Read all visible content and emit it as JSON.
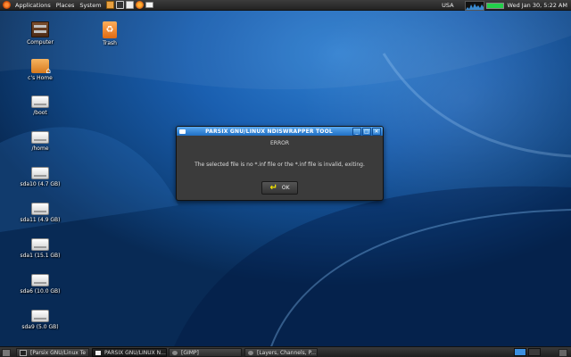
{
  "top_panel": {
    "menus": [
      "Applications",
      "Places",
      "System"
    ],
    "launcher_icons": [
      "file-manager-icon",
      "terminal-icon",
      "text-editor-icon",
      "firefox-icon",
      "email-icon"
    ],
    "keyboard_layout": "USA",
    "clock": "Wed Jan 30,  5:22 AM"
  },
  "desktop": {
    "icons": [
      {
        "label": "Computer",
        "icon": "computer-icon"
      },
      {
        "label": "Trash",
        "icon": "trash-icon"
      },
      {
        "label": "c's Home",
        "icon": "home-folder-icon"
      },
      {
        "label": "/boot",
        "icon": "drive-icon"
      },
      {
        "label": "/home",
        "icon": "drive-icon"
      },
      {
        "label": "sda10 (4.7 GB)",
        "icon": "drive-icon"
      },
      {
        "label": "sda11 (4.9 GB)",
        "icon": "drive-icon"
      },
      {
        "label": "sda1 (15.1 GB)",
        "icon": "drive-icon"
      },
      {
        "label": "sda6 (10.0 GB)",
        "icon": "drive-icon"
      },
      {
        "label": "sda9 (5.0 GB)",
        "icon": "drive-icon"
      }
    ]
  },
  "dialog": {
    "title": "PARSIX GNU/LINUX NDISWRAPPER TOOL",
    "heading": "ERROR",
    "message": "The selected file is no *.inf file or the *.inf file is invalid, exiting.",
    "ok_label": "OK",
    "window_buttons": [
      "_",
      "□",
      "✕"
    ]
  },
  "taskbar": {
    "tasks": [
      {
        "label": "[Parsix GNU/Linux Te",
        "icon": "terminal-icon"
      },
      {
        "label": "PARSIX GNU/LINUX N...",
        "icon": "window-icon"
      },
      {
        "label": "[GIMP]",
        "icon": "gimp-icon"
      },
      {
        "label": "[Layers, Channels, P...",
        "icon": "gimp-icon"
      }
    ],
    "workspaces": 2
  },
  "colors": {
    "accent_blue": "#2b7cd0",
    "ok_icon_yellow": "#f2e300",
    "panel_dark": "#2a2a2a",
    "netbar_green": "#22d04a"
  }
}
